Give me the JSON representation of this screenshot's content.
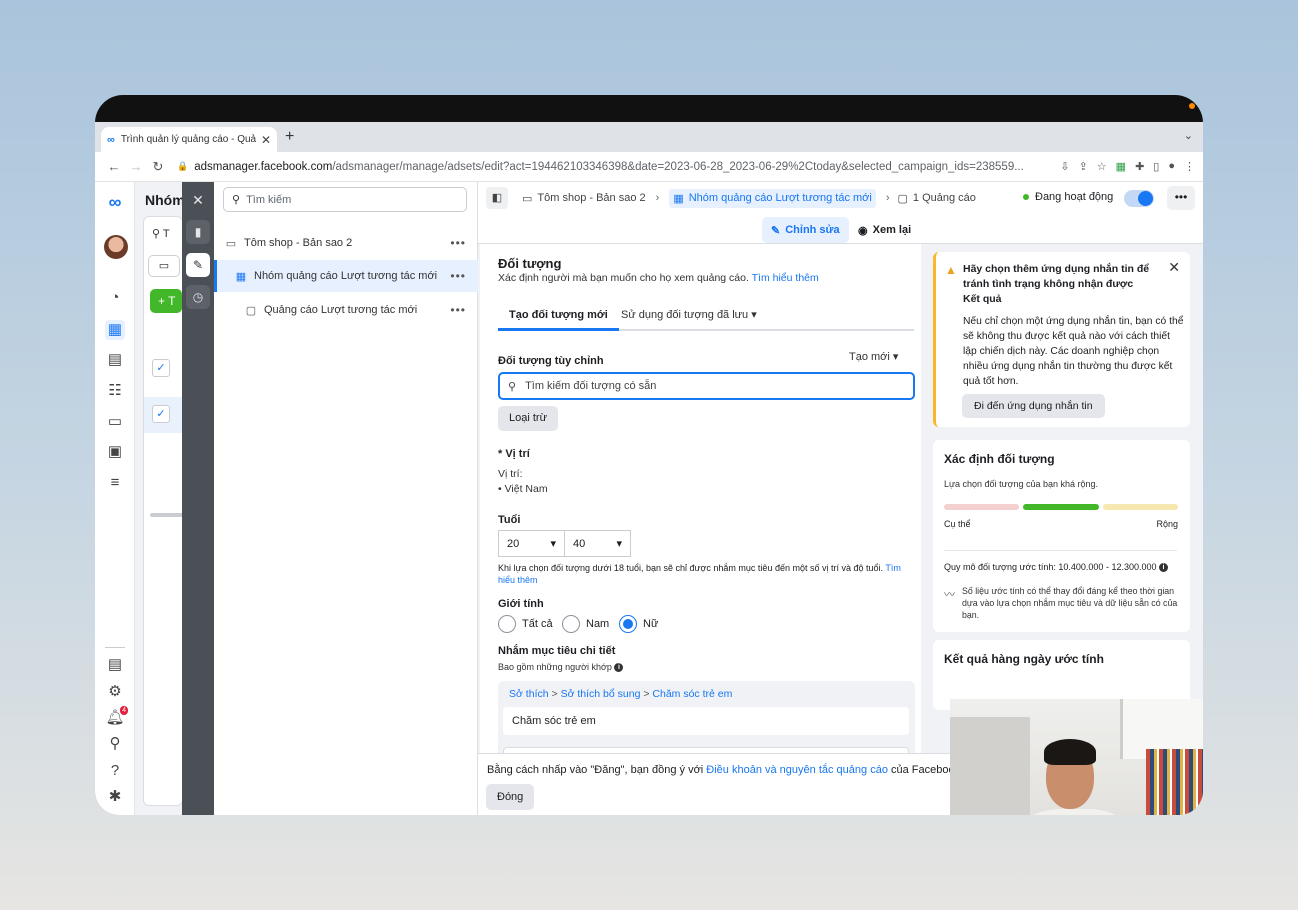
{
  "browser": {
    "tab_title": "Trình quản lý quảng cáo - Quả",
    "url_host": "adsmanager.facebook.com",
    "url_path": "/adsmanager/manage/adsets/edit?act=194462103346398&date=2023-06-28_2023-06-29%2Ctoday&selected_campaign_ids=238559..."
  },
  "background_list": {
    "title": "Nhóm",
    "search_stub": "T",
    "create_stub": "T"
  },
  "tree": {
    "search_placeholder": "Tìm kiếm",
    "campaign": "Tôm shop - Bản sao 2",
    "adset": "Nhóm quảng cáo Lượt tương tác mới",
    "ad": "Quảng cáo Lượt tương tác mới"
  },
  "breadcrumb": {
    "campaign": "Tôm shop - Bản sao 2",
    "adset": "Nhóm quảng cáo Lượt tương tác mới",
    "ads": "1 Quảng cáo"
  },
  "status": {
    "label": "Đang hoạt động",
    "toggle_on": true
  },
  "mode": {
    "edit": "Chỉnh sửa",
    "review": "Xem lại"
  },
  "audience": {
    "title": "Đối tượng",
    "description": "Xác định người mà bạn muốn cho họ xem quảng cáo.",
    "learn_more": "Tìm hiểu thêm",
    "tab_new": "Tạo đối tượng mới",
    "tab_saved": "Sử dụng đối tượng đã lưu",
    "custom_label": "Đối tượng tùy chỉnh",
    "create_new": "Tạo mới",
    "search_placeholder": "Tìm kiếm đối tượng có sẵn",
    "exclude": "Loại trừ",
    "location_label": "* Vị trí",
    "location_sub": "Vị trí:",
    "location_value": "Việt Nam",
    "age_label": "Tuổi",
    "age_min": "20",
    "age_max": "40",
    "age_note": "Khi lựa chọn đối tượng dưới 18 tuổi, bạn sẽ chỉ được nhắm mục tiêu đến một số vị trí và độ tuổi.",
    "age_note_link": "Tìm hiểu thêm",
    "gender_label": "Giới tính",
    "gender_options": [
      "Tất cả",
      "Nam",
      "Nữ"
    ],
    "gender_selected": "Nữ",
    "detailed_label": "Nhắm mục tiêu chi tiết",
    "detailed_sub": "Bao gồm những người khớp",
    "interest_path": [
      "Sở thích",
      "Sở thích bổ sung",
      "Chăm sóc trẻ em"
    ],
    "interest_item": "Chăm sóc trẻ em"
  },
  "footer": {
    "text_before": "Bằng cách nhấp vào \"Đăng\", bạn đồng ý với",
    "terms_link": "Điều khoản và nguyên tắc quảng cáo",
    "text_after": "của Facebook.",
    "close": "Đóng"
  },
  "warning": {
    "title": "Hãy chọn thêm ứng dụng nhắn tin để tránh tình trạng không nhận được Kết quả",
    "body": "Nếu chỉ chọn một ứng dụng nhắn tin, bạn có thể sẽ không thu được kết quả nào với cách thiết lập chiến dịch này. Các doanh nghiệp chọn nhiều ứng dụng nhắn tin thường thu được kết quả tốt hơn.",
    "button": "Đi đến ứng dụng nhắn tin",
    "color": "#f7b928"
  },
  "audience_def": {
    "title": "Xác định đối tượng",
    "desc": "Lựa chọn đối tượng của bạn khá rộng.",
    "low": "Cụ thể",
    "high": "Rộng",
    "size": "Quy mô đối tượng ước tính: 10.400.000 - 12.300.000",
    "note": "Số liệu ước tính có thể thay đổi đáng kể theo thời gian dựa vào lựa chọn nhắm mục tiêu và dữ liệu sẵn có của bạn.",
    "meter_position": "broad-middle"
  },
  "daily": {
    "title": "Kết quả hàng ngày ước tính"
  },
  "nav": {
    "notification_count": "4"
  },
  "colors": {
    "accent": "#1877f2",
    "active_green": "#42b72a"
  }
}
